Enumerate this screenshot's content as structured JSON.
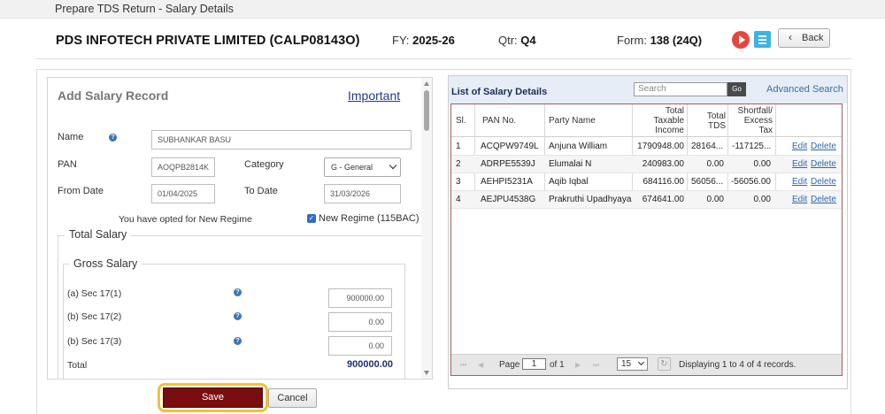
{
  "window": {
    "title": "Prepare TDS Return - Salary Details"
  },
  "header": {
    "company": "PDS INFOTECH PRIVATE LIMITED (CALP08143O)",
    "fy_label": "FY:",
    "fy_value": "2025-26",
    "qtr_label": "Qtr:",
    "qtr_value": "Q4",
    "form_label": "Form:",
    "form_value": "138 (24Q)",
    "back_label": "Back",
    "icons": [
      "play-icon",
      "document-icon",
      "chevron-left-icon"
    ]
  },
  "form": {
    "title": "Add Salary Record",
    "important_link": "Important",
    "name_label": "Name",
    "name_value": "SUBHANKAR BASU",
    "pan_label": "PAN",
    "pan_value": "AOQPB2814K",
    "category_label": "Category",
    "category_value": "G - General",
    "from_label": "From Date",
    "from_value": "01/04/2025",
    "to_label": "To Date",
    "to_value": "31/03/2026",
    "regime_note": "You have opted for New Regime",
    "regime_checkbox": "New Regime (115BAC)",
    "regime_checked": true,
    "total_salary_legend": "Total Salary",
    "gross_salary_legend": "Gross Salary",
    "sec17_1_label": "(a) Sec 17(1)",
    "sec17_1_value": "900000.00",
    "sec17_2_label": "(b) Sec 17(2)",
    "sec17_2_value": "0.00",
    "sec17_3_label": "(b) Sec 17(3)",
    "sec17_3_value": "0.00",
    "total_label": "Total",
    "total_value": "900000.00",
    "save_label": "Save",
    "cancel_label": "Cancel"
  },
  "list": {
    "title": "List of Salary Details",
    "search_placeholder": "Search",
    "go_label": "Go",
    "advanced_search": "Advanced Search",
    "columns": {
      "sl": "Sl.",
      "pan": "PAN No.",
      "party": "Party Name",
      "income_1": "Total",
      "income_2": "Taxable",
      "income_3": "Income",
      "tds_1": "Total",
      "tds_2": "TDS",
      "short_1": "Shortfall/",
      "short_2": "Excess",
      "short_3": "Tax"
    },
    "rows": [
      {
        "sl": "1",
        "pan": "ACQPW9749L",
        "party": "Anjuna William",
        "income": "1790948.00",
        "tds": "28164...",
        "shortfall": "-117125...",
        "edit": "Edit",
        "delete": "Delete"
      },
      {
        "sl": "2",
        "pan": "ADRPE5539J",
        "party": "Elumalai N",
        "income": "240983.00",
        "tds": "0.00",
        "shortfall": "0.00",
        "edit": "Edit",
        "delete": "Delete"
      },
      {
        "sl": "3",
        "pan": "AEHPI5231A",
        "party": "Aqib Iqbal",
        "income": "684116.00",
        "tds": "56056...",
        "shortfall": "-56056.00",
        "edit": "Edit",
        "delete": "Delete"
      },
      {
        "sl": "4",
        "pan": "AEJPU4538G",
        "party": "Prakruthi Upadhyaya",
        "income": "674641.00",
        "tds": "0.00",
        "shortfall": "0.00",
        "edit": "Edit",
        "delete": "Delete"
      }
    ],
    "pager": {
      "page_label": "Page",
      "page_value": "1",
      "of_label": "of 1",
      "page_size": "15",
      "display_text": "Displaying 1 to 4 of 4 records."
    }
  },
  "colors": {
    "save": "#7a0d0d",
    "highlight_ring": "#f1c232",
    "link": "#2d68b0",
    "play": "#e8453c",
    "doc": "#3ab3e8"
  }
}
